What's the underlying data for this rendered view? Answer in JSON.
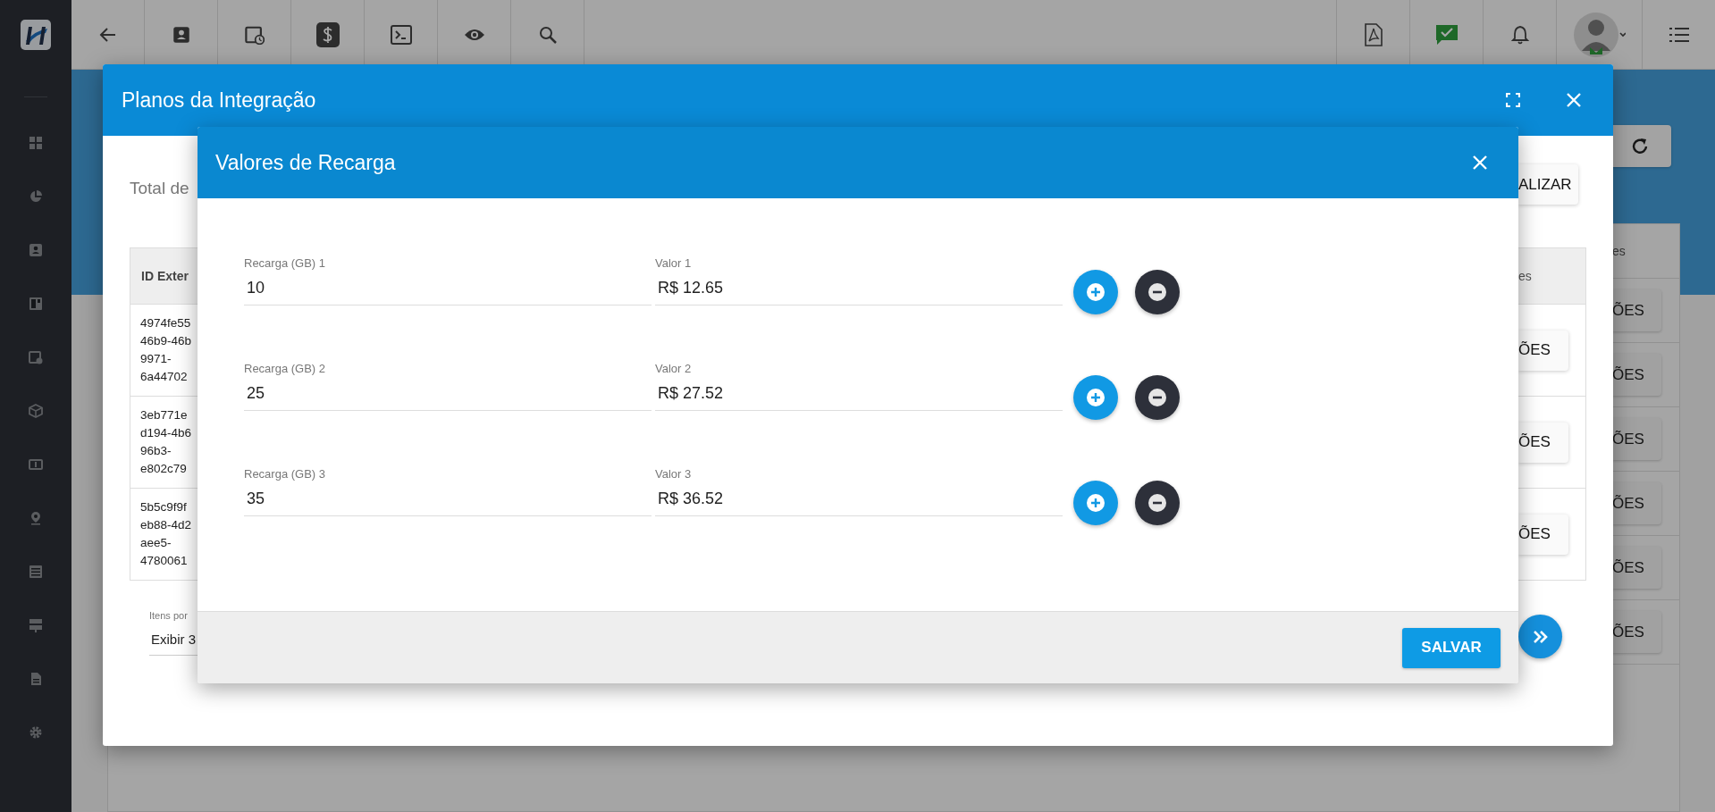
{
  "background_page": {
    "panel": {
      "column_header": "es",
      "row_buttons": [
        "ÕES",
        "ÕES",
        "ÕES",
        "ÕES",
        "ÕES",
        "ÕES"
      ]
    }
  },
  "integration_dialog": {
    "title": "Planos da Integração",
    "total_label": "Total de",
    "update_button": "ALIZAR",
    "table": {
      "columns": [
        "ID Exter",
        "es"
      ],
      "rows": [
        {
          "id_lines": [
            "4974fe55",
            "46b9-46b",
            "9971-",
            "6a44702"
          ],
          "action_button": "ÕES"
        },
        {
          "id_lines": [
            "3eb771e",
            "d194-4b6",
            "96b3-",
            "e802c79"
          ],
          "action_button": "ÕES"
        },
        {
          "id_lines": [
            "5b5c9f9f",
            "eb88-4d2",
            "aee5-",
            "4780061"
          ],
          "action_button": "ÕES"
        }
      ]
    },
    "pagination": {
      "items_per_page_label": "Itens por",
      "value": "Exibir 3"
    }
  },
  "recharge_dialog": {
    "title": "Valores de Recarga",
    "rows": [
      {
        "gb_label": "Recarga (GB) 1",
        "gb_value": "10",
        "value_label": "Valor 1",
        "value": "R$ 12.65"
      },
      {
        "gb_label": "Recarga (GB) 2",
        "gb_value": "25",
        "value_label": "Valor 2",
        "value": "R$ 27.52"
      },
      {
        "gb_label": "Recarga (GB) 3",
        "gb_value": "35",
        "value_label": "Valor 3",
        "value": "R$ 36.52"
      }
    ],
    "save_button": "SALVAR"
  }
}
